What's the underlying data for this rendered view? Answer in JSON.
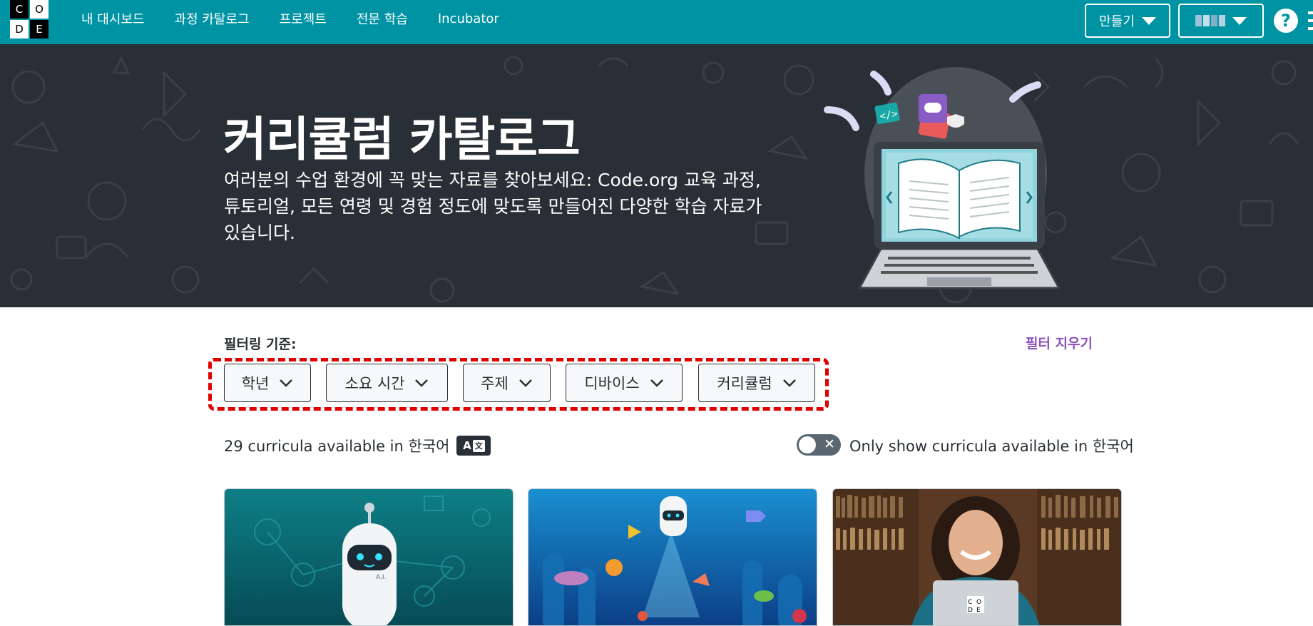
{
  "header": {
    "logo_letters": [
      "C",
      "O",
      "D",
      "E"
    ],
    "nav": [
      "내 대시보드",
      "과정 카탈로그",
      "프로젝트",
      "전문 학습",
      "Incubator"
    ],
    "create_label": "만들기",
    "help_symbol": "?",
    "user_menu_pixel_colors": [
      "#9ec2d6",
      "#c7dde8",
      "#7fb0c8",
      "#b5d1df"
    ]
  },
  "hero": {
    "title": "커리큘럼 카탈로그",
    "description": "여러분의 수업 환경에 꼭 맞는 자료를 찾아보세요: Code.org 교육 과정, 튜토리얼, 모든 연령 및 경험 정도에 맞도록 만들어진 다양한 학습 자료가 있습니다."
  },
  "filters": {
    "label": "필터링 기준:",
    "clear": "필터 지우기",
    "buttons": [
      "학년",
      "소요 시간",
      "주제",
      "디바이스",
      "커리큘럼"
    ]
  },
  "availability": {
    "count_text": "29 curricula available in 한국어",
    "badge_left": "A",
    "badge_right": "文",
    "toggle_label": "Only show curricula available in 한국어",
    "toggle_on": false
  },
  "cards": [
    {
      "image": "ai-robot-illustration"
    },
    {
      "image": "ai-ocean-robot-illustration"
    },
    {
      "image": "teacher-with-laptop-photo",
      "laptop_letters": [
        "C",
        "O",
        "D",
        "E"
      ]
    }
  ],
  "colors": {
    "brand_teal": "#0093a4",
    "hero_bg": "#292f36",
    "clear_link": "#8c52ba",
    "highlight_dashed": "#e00000"
  }
}
